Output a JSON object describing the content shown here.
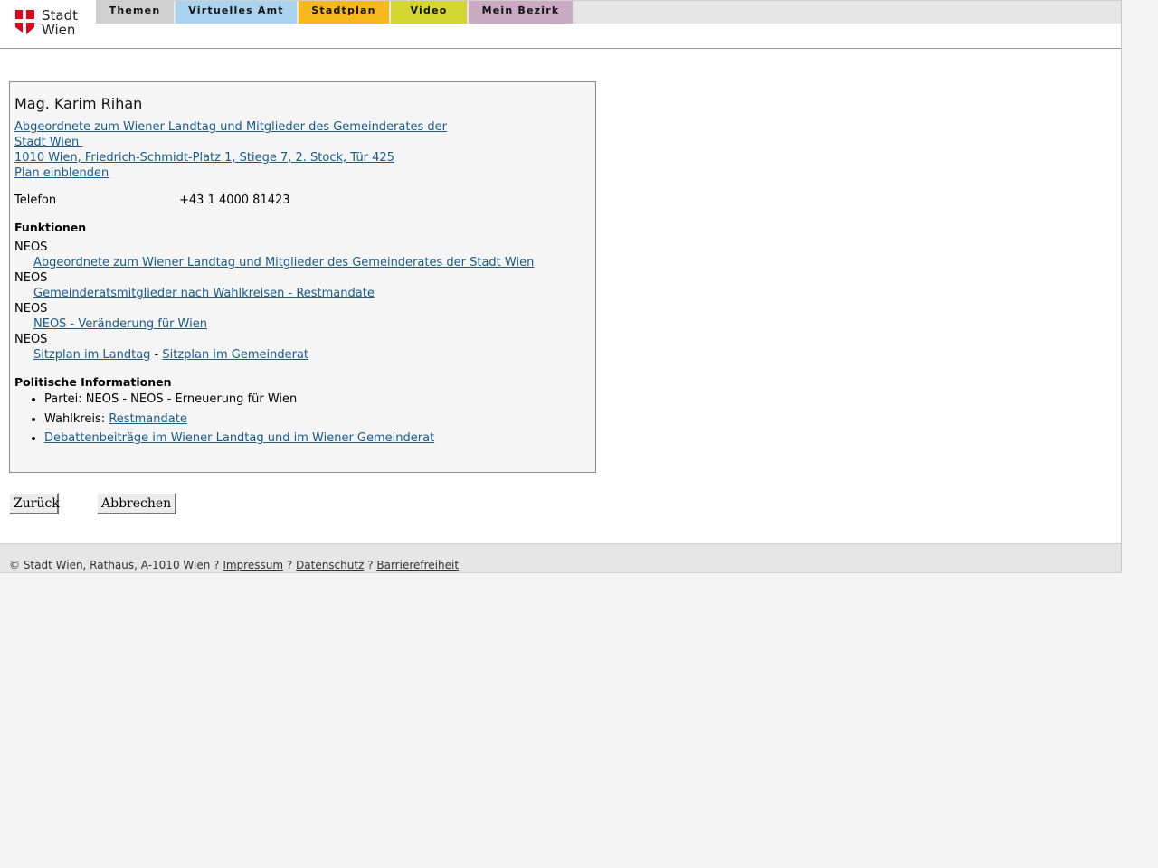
{
  "header": {
    "logo_line1": "Stadt",
    "logo_line2": "Wien",
    "tabs": [
      {
        "label": "Themen",
        "color": "#d0d0d0"
      },
      {
        "label": "Virtuelles Amt",
        "color": "#a9d3ef"
      },
      {
        "label": "Stadtplan",
        "color": "#f6b81c"
      },
      {
        "label": "Video",
        "color": "#d3d62e"
      },
      {
        "label": "Mein Bezirk",
        "color": "#cbaac3"
      }
    ]
  },
  "person": {
    "name": "Mag. Karim Rihan",
    "org_line1": "Abgeordnete zum Wiener Landtag und Mitglieder des Gemeinderates der",
    "org_line2": "Stadt Wien ",
    "address": "1010 Wien, Friedrich-Schmidt-Platz 1, Stiege 7, 2. Stock, Tür 425",
    "plan_link": "Plan einblenden",
    "phone_label": "Telefon",
    "phone_value": "+43 1 4000 81423"
  },
  "functions": {
    "title": "Funktionen",
    "items": [
      {
        "party": "NEOS",
        "link": "Abgeordnete zum Wiener Landtag und Mitglieder des Gemeinderates der Stadt Wien"
      },
      {
        "party": "NEOS",
        "link": "Gemeinderatsmitglieder nach Wahlkreisen - Restmandate"
      },
      {
        "party": "NEOS",
        "link": "NEOS - Veränderung für Wien"
      },
      {
        "party": "NEOS",
        "link_a": "Sitzplan im Landtag",
        "separator": " - ",
        "link_b": "Sitzplan im Gemeinderat"
      }
    ]
  },
  "political": {
    "title": "Politische Informationen",
    "party_text": "Partei: NEOS - NEOS - Erneuerung für Wien",
    "district_label": "Wahlkreis: ",
    "district_link": "Restmandate",
    "debates_link": "Debattenbeiträge im Wiener Landtag und im Wiener Gemeinderat"
  },
  "buttons": {
    "back": "Zurück",
    "cancel": "Abbrechen"
  },
  "footer": {
    "copyright": "© Stadt Wien, Rathaus, A-1010 Wien ? ",
    "impressum": "Impressum",
    "sep1": " ? ",
    "datenschutz": "Datenschutz",
    "sep2": " ? ",
    "barrierefreiheit": "Barrierefreiheit"
  },
  "colors": {
    "logo_red": "#e2001a",
    "link": "#1a5a8a"
  }
}
